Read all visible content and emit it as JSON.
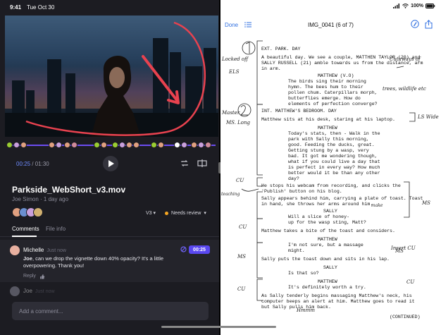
{
  "status": {
    "time": "9:41",
    "date": "Tue Oct 30",
    "battery": "100%"
  },
  "player": {
    "current_time": "00:25",
    "total_time": "01:30",
    "separator": " / "
  },
  "asset": {
    "title": "Parkside_WebShort_v3.mov",
    "subtitle": "Joe Simon · 1 day ago",
    "version": "V3",
    "status": "Needs review",
    "status_color": "#f5a623"
  },
  "tabs": [
    {
      "label": "Comments"
    },
    {
      "label": "File info"
    }
  ],
  "comments": [
    {
      "author": "Michelle",
      "time": "Just now",
      "body": "Joe, can we drop the vignette down 40% opacity? It's a little overpowering. Thank you!",
      "mention": "Joe",
      "timestamp": "00:25",
      "reply_label": "Reply"
    },
    {
      "author": "Joe",
      "time": "Just now"
    }
  ],
  "add_comment": {
    "placeholder": "Add a comment..."
  },
  "doc": {
    "done_label": "Done",
    "title": "IMG_0041 (6 of 7)"
  },
  "script_lines": [
    "EXT. PARK. DAY",
    "A beautiful day. We see a couple, MATTHEN TAYLOR (20) and",
    "SALLY RUSSELL (21) amble towards us from the distance, arm",
    "in arm.",
    "MATTHEW (V.O)",
    "The birds sing their morning",
    "hymn. The bees hum to their",
    "pollen chum. Caterpillars morph,",
    "butterflies emerge. How do",
    "elements of perfection converge?",
    "INT. MATTHEW'S BEDROOM. DAY",
    "Matthew sits at his desk, staring at his laptop.",
    "MATTHEW",
    "Today's stats, then - Walk in the",
    "park with Sally this morning,",
    "good. Feeding the ducks, great.",
    "Getting stung by a wasp, very",
    "bad. It got me wondering though,",
    "what if you could live a day that",
    "is perfect in every way? How much",
    "better would it be than any other",
    "day?",
    "He stops his webcam from recording, and clicks the",
    "'Publish' button on his blog.",
    "Sally appears behind him, carrying a plate of toast. Toast",
    "in hand, she throws her arms around him.",
    "SALLY",
    "Will a slice of honey-",
    "up for the wasp sting, Matt?",
    "Matthew takes a bite of the toast and considers.",
    "MATTHEW",
    "I'm not sure, but a massage",
    "might.",
    "Sally puts the toast down and sits in his lap.",
    "SALLY",
    "Is that so?",
    "MATTHEW",
    "It's definitely worth a try.",
    "As Sally tenderly begins massaging Matthew's neck, his",
    "computer beeps an alert at him. Matthew goes to read it",
    "but Sally pulls him back.",
    "(CONTINUED)"
  ],
  "handwriting": [
    "Locked off",
    "ELS",
    "Cutaways of",
    "trees, wildlife etc",
    "Master",
    "MS. Long",
    "LS Wide",
    "CU",
    "MS",
    "CU",
    "MS",
    "CU",
    "MS",
    "CU",
    "Insert CU",
    "Hmmm",
    "teaching",
    "make"
  ]
}
